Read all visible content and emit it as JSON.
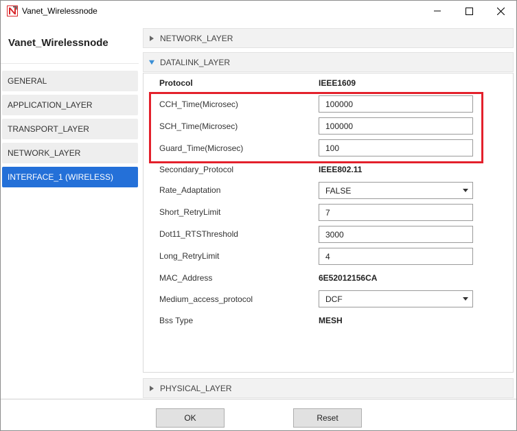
{
  "window": {
    "title": "Vanet_Wirelessnode",
    "controls": [
      "minimize-icon",
      "maximize-icon",
      "close-icon"
    ]
  },
  "sidebar": {
    "node_title": "Vanet_Wirelessnode",
    "items": [
      {
        "label": "GENERAL",
        "active": false
      },
      {
        "label": "APPLICATION_LAYER",
        "active": false
      },
      {
        "label": "TRANSPORT_LAYER",
        "active": false
      },
      {
        "label": "NETWORK_LAYER",
        "active": false
      },
      {
        "label": "INTERFACE_1 (WIRELESS)",
        "active": true
      }
    ]
  },
  "sections": {
    "network_layer": {
      "label": "NETWORK_LAYER",
      "expanded": false
    },
    "datalink_layer": {
      "label": "DATALINK_LAYER",
      "expanded": true
    },
    "physical_layer": {
      "label": "PHYSICAL_LAYER",
      "expanded": false
    }
  },
  "datalink": {
    "protocol": {
      "label": "Protocol",
      "value": "IEEE1609"
    },
    "cch_time": {
      "label": "CCH_Time(Microsec)",
      "value": "100000"
    },
    "sch_time": {
      "label": "SCH_Time(Microsec)",
      "value": "100000"
    },
    "guard_time": {
      "label": "Guard_Time(Microsec)",
      "value": "100"
    },
    "secondary_protocol": {
      "label": "Secondary_Protocol",
      "value": "IEEE802.11"
    },
    "rate_adaptation": {
      "label": "Rate_Adaptation",
      "value": "FALSE"
    },
    "short_retry_limit": {
      "label": "Short_RetryLimit",
      "value": "7"
    },
    "rts_threshold": {
      "label": "Dot11_RTSThreshold",
      "value": "3000"
    },
    "long_retry_limit": {
      "label": "Long_RetryLimit",
      "value": "4"
    },
    "mac_address": {
      "label": "MAC_Address",
      "value": "6E52012156CA"
    },
    "medium_access_protocol": {
      "label": "Medium_access_protocol",
      "value": "DCF"
    },
    "bss_type": {
      "label": "Bss Type",
      "value": "MESH"
    }
  },
  "footer": {
    "ok_label": "OK",
    "reset_label": "Reset"
  },
  "colors": {
    "accent": "#2470d8",
    "highlight": "#e3202b",
    "expanded_arrow": "#3a8fd6",
    "app_icon_red": "#d9262a"
  }
}
